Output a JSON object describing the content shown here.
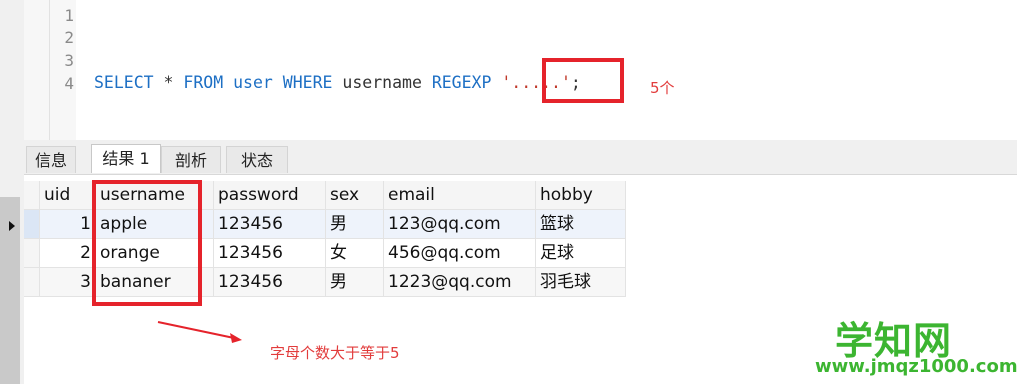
{
  "editor": {
    "line_numbers": [
      "1",
      "2",
      "3",
      "4"
    ],
    "code": {
      "kw_select": "SELECT",
      "star": " * ",
      "kw_from": "FROM",
      "sp1": " ",
      "table": "user",
      "sp2": " ",
      "kw_where": "WHERE",
      "column": " username ",
      "kw_regexp": "REGEXP",
      "sp3": " ",
      "pattern": "'.....'",
      "semicolon": ";"
    },
    "annotation": "5个"
  },
  "tabs": [
    "信息",
    "结果 1",
    "剖析",
    "状态"
  ],
  "active_tab": "结果 1",
  "table": {
    "columns": [
      "uid",
      "username",
      "password",
      "sex",
      "email",
      "hobby"
    ],
    "rows": [
      {
        "uid": "1",
        "username": "apple",
        "password": "123456",
        "sex": "男",
        "email": "123@qq.com",
        "hobby": "篮球"
      },
      {
        "uid": "2",
        "username": "orange",
        "password": "123456",
        "sex": "女",
        "email": "456@qq.com",
        "hobby": "足球"
      },
      {
        "uid": "3",
        "username": "bananer",
        "password": "123456",
        "sex": "男",
        "email": "1223@qq.com",
        "hobby": "羽毛球"
      }
    ]
  },
  "annotations": {
    "bottom_note": "字母个数大于等于5",
    "accent_color": "#e5232b"
  },
  "watermark": {
    "title": "学知网",
    "url": "www.jmqz1000.com",
    "color": "#3cb531"
  }
}
